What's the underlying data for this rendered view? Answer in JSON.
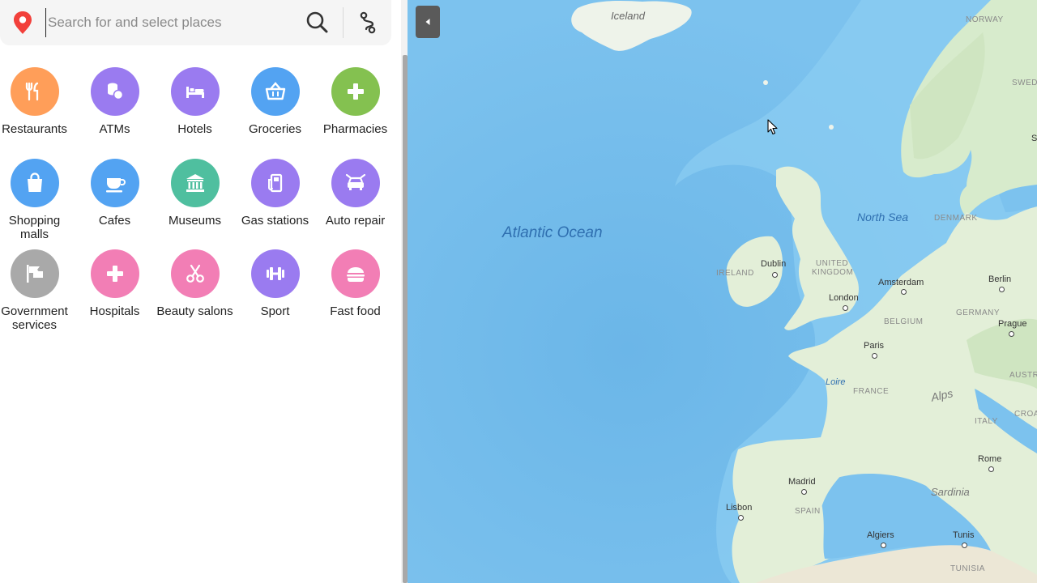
{
  "search": {
    "placeholder": "Search for and select places",
    "value": ""
  },
  "categories": [
    {
      "label": "Restaurants",
      "icon": "fork-knife-icon",
      "color": "#ff9e59"
    },
    {
      "label": "ATMs",
      "icon": "coins-icon",
      "color": "#9a7bf0"
    },
    {
      "label": "Hotels",
      "icon": "bed-icon",
      "color": "#9a7bf0"
    },
    {
      "label": "Groceries",
      "icon": "basket-icon",
      "color": "#53a3f2"
    },
    {
      "label": "Pharmacies",
      "icon": "plus-icon",
      "color": "#84c150"
    },
    {
      "label": "Shopping malls",
      "icon": "shopping-bag-icon",
      "color": "#53a3f2"
    },
    {
      "label": "Cafes",
      "icon": "cup-icon",
      "color": "#53a3f2"
    },
    {
      "label": "Museums",
      "icon": "museum-icon",
      "color": "#4fbf9f"
    },
    {
      "label": "Gas stations",
      "icon": "fuel-icon",
      "color": "#9a7bf0"
    },
    {
      "label": "Auto repair",
      "icon": "car-repair-icon",
      "color": "#9a7bf0"
    },
    {
      "label": "Government services",
      "icon": "flag-icon",
      "color": "#a9a9a9"
    },
    {
      "label": "Hospitals",
      "icon": "plus-icon",
      "color": "#f27eb5"
    },
    {
      "label": "Beauty salons",
      "icon": "scissors-icon",
      "color": "#f27eb5"
    },
    {
      "label": "Sport",
      "icon": "dumbbell-icon",
      "color": "#9a7bf0"
    },
    {
      "label": "Fast food",
      "icon": "burger-icon",
      "color": "#f27eb5"
    }
  ],
  "map": {
    "water_labels": {
      "ocean": "Atlantic Ocean",
      "north_sea": "North Sea",
      "loire": "Loire"
    },
    "countries": {
      "iceland": "Iceland",
      "norway": "NORWAY",
      "sweden": "SWEDEN",
      "denmark": "DENMARK",
      "ireland": "IRELAND",
      "uk": "UNITED KINGDOM",
      "belgium": "BELGIUM",
      "germany": "GERMANY",
      "france": "FRANCE",
      "italy": "ITALY",
      "austria": "AUSTRIA",
      "croatia": "CROA",
      "spain": "SPAIN",
      "tunisia": "TUNISIA"
    },
    "regions": {
      "alps": "Alps",
      "sardinia": "Sardinia"
    },
    "cities": {
      "dublin": "Dublin",
      "london": "London",
      "amsterdam": "Amsterdam",
      "berlin": "Berlin",
      "prague": "Prague",
      "paris": "Paris",
      "madrid": "Madrid",
      "lisbon": "Lisbon",
      "rome": "Rome",
      "algiers": "Algiers",
      "tunis": "Tunis",
      "edge_s": "S"
    },
    "colors": {
      "water": "#7cc2ee",
      "land": "#e3efd8",
      "forest": "#cfe5c1"
    }
  }
}
